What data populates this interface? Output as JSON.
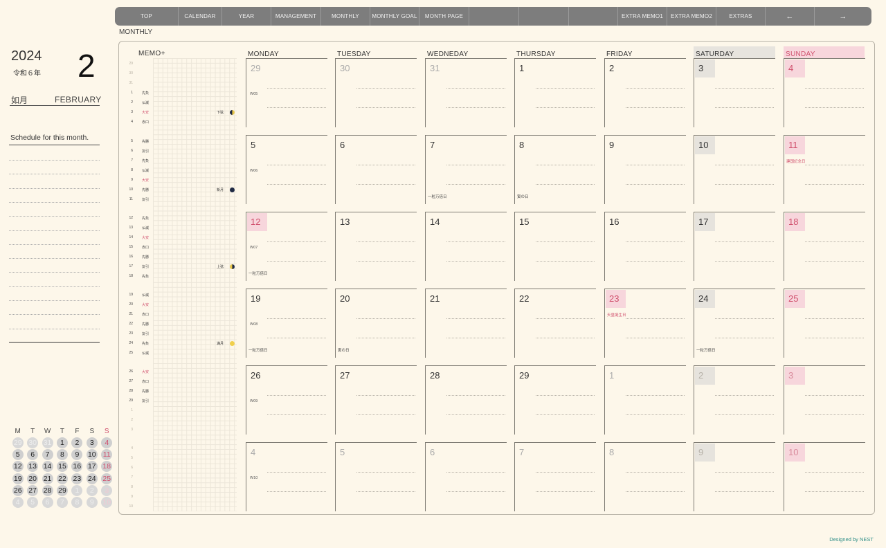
{
  "nav": {
    "tabs": [
      {
        "label": "TOP",
        "w": 92
      },
      {
        "label": "CALENDAR",
        "w": 63
      },
      {
        "label": "YEAR",
        "w": 71
      },
      {
        "label": "MANAGEMENT",
        "w": 72
      },
      {
        "label": "MONTHLY",
        "w": 71
      },
      {
        "label": "MONTHLY GOAL",
        "w": 71
      },
      {
        "label": "MONTH PAGE",
        "w": 72
      },
      {
        "label": "",
        "w": 72
      },
      {
        "label": "",
        "w": 72
      },
      {
        "label": "",
        "w": 71
      },
      {
        "label": "EXTRA MEMO1",
        "w": 71
      },
      {
        "label": "EXTRA MEMO2",
        "w": 71
      },
      {
        "label": "EXTRAS",
        "w": 71
      },
      {
        "label": "←",
        "w": 71
      },
      {
        "label": "→",
        "w": 82
      }
    ]
  },
  "page_label": "MONTHLY",
  "sidebar": {
    "year": "2024",
    "era": "令和６年",
    "month_number": "2",
    "month_jp": "如月",
    "month_en": "FEBRUARY",
    "schedule_title": "Schedule for this month."
  },
  "mini_calendar": {
    "headers": [
      "M",
      "T",
      "W",
      "T",
      "F",
      "S",
      "S"
    ],
    "weeks": [
      [
        [
          "29",
          1
        ],
        [
          "30",
          1
        ],
        [
          "31",
          1
        ],
        [
          "1",
          0
        ],
        [
          "2",
          0
        ],
        [
          "3",
          0
        ],
        [
          "4",
          0
        ]
      ],
      [
        [
          "5",
          0
        ],
        [
          "6",
          0
        ],
        [
          "7",
          0
        ],
        [
          "8",
          0
        ],
        [
          "9",
          0
        ],
        [
          "10",
          0
        ],
        [
          "11",
          0
        ]
      ],
      [
        [
          "12",
          0
        ],
        [
          "13",
          0
        ],
        [
          "14",
          0
        ],
        [
          "15",
          0
        ],
        [
          "16",
          0
        ],
        [
          "17",
          0
        ],
        [
          "18",
          0
        ]
      ],
      [
        [
          "19",
          0
        ],
        [
          "20",
          0
        ],
        [
          "21",
          0
        ],
        [
          "22",
          0
        ],
        [
          "23",
          0
        ],
        [
          "24",
          0
        ],
        [
          "25",
          0
        ]
      ],
      [
        [
          "26",
          0
        ],
        [
          "27",
          0
        ],
        [
          "28",
          0
        ],
        [
          "29",
          0
        ],
        [
          "1",
          1
        ],
        [
          "2",
          1
        ],
        [
          "3",
          1
        ]
      ],
      [
        [
          "4",
          1
        ],
        [
          "5",
          1
        ],
        [
          "6",
          1
        ],
        [
          "7",
          1
        ],
        [
          "8",
          1
        ],
        [
          "9",
          1
        ],
        [
          "10",
          1
        ]
      ]
    ]
  },
  "memo": {
    "title": "MEMO+",
    "rows": [
      {
        "d": "29",
        "rk": "",
        "f": 1
      },
      {
        "d": "30",
        "rk": "",
        "f": 1
      },
      {
        "d": "31",
        "rk": "",
        "f": 1
      },
      {
        "d": "1",
        "rk": "先負"
      },
      {
        "d": "2",
        "rk": "仏滅"
      },
      {
        "d": "3",
        "rk": "大安",
        "r": 1
      },
      {
        "d": "4",
        "rk": "赤口"
      },
      {
        "d": "5",
        "rk": "先勝"
      },
      {
        "d": "6",
        "rk": "友引"
      },
      {
        "d": "7",
        "rk": "先負"
      },
      {
        "d": "8",
        "rk": "仏滅"
      },
      {
        "d": "9",
        "rk": "大安",
        "r": 1
      },
      {
        "d": "10",
        "rk": "先勝"
      },
      {
        "d": "11",
        "rk": "友引"
      },
      {
        "d": "12",
        "rk": "先負"
      },
      {
        "d": "13",
        "rk": "仏滅"
      },
      {
        "d": "14",
        "rk": "大安",
        "r": 1
      },
      {
        "d": "15",
        "rk": "赤口"
      },
      {
        "d": "16",
        "rk": "先勝"
      },
      {
        "d": "17",
        "rk": "友引"
      },
      {
        "d": "18",
        "rk": "先負"
      },
      {
        "d": "19",
        "rk": "仏滅"
      },
      {
        "d": "20",
        "rk": "大安",
        "r": 1
      },
      {
        "d": "21",
        "rk": "赤口"
      },
      {
        "d": "22",
        "rk": "先勝"
      },
      {
        "d": "23",
        "rk": "友引"
      },
      {
        "d": "24",
        "rk": "先負"
      },
      {
        "d": "25",
        "rk": "仏滅"
      },
      {
        "d": "26",
        "rk": "大安",
        "r": 1
      },
      {
        "d": "27",
        "rk": "赤口"
      },
      {
        "d": "28",
        "rk": "先勝"
      },
      {
        "d": "29",
        "rk": "友引"
      },
      {
        "d": "1",
        "rk": "",
        "f": 1
      },
      {
        "d": "2",
        "rk": "",
        "f": 1
      },
      {
        "d": "3",
        "rk": "",
        "f": 1
      },
      {
        "d": "4",
        "rk": "",
        "f": 1
      },
      {
        "d": "5",
        "rk": "",
        "f": 1
      },
      {
        "d": "6",
        "rk": "",
        "f": 1
      },
      {
        "d": "7",
        "rk": "",
        "f": 1
      },
      {
        "d": "8",
        "rk": "",
        "f": 1
      },
      {
        "d": "9",
        "rk": "",
        "f": 1
      },
      {
        "d": "10",
        "rk": "",
        "f": 1
      }
    ],
    "moons": [
      {
        "row": 5,
        "label": "下弦",
        "phase": "last-quarter"
      },
      {
        "row": 12,
        "label": "新月",
        "phase": "new"
      },
      {
        "row": 19,
        "label": "上弦",
        "phase": "first-quarter"
      },
      {
        "row": 26,
        "label": "満月",
        "phase": "full"
      }
    ]
  },
  "weekdays": [
    "MONDAY",
    "TUESDAY",
    "WEDNEDAY",
    "THURSDAY",
    "FRIDAY",
    "SATURDAY",
    "SUNDAY"
  ],
  "weeks": [
    {
      "wk": "W05",
      "days": [
        {
          "n": "29",
          "o": 1
        },
        {
          "n": "30",
          "o": 1
        },
        {
          "n": "31",
          "o": 1
        },
        {
          "n": "1"
        },
        {
          "n": "2"
        },
        {
          "n": "3"
        },
        {
          "n": "4"
        }
      ]
    },
    {
      "wk": "W06",
      "days": [
        {
          "n": "5"
        },
        {
          "n": "6"
        },
        {
          "n": "7",
          "note": "一粒万倍日"
        },
        {
          "n": "8",
          "note": "寅の日"
        },
        {
          "n": "9"
        },
        {
          "n": "10"
        },
        {
          "n": "11",
          "hname": "建国記念日"
        }
      ]
    },
    {
      "wk": "W07",
      "days": [
        {
          "n": "12",
          "hol": 1,
          "note": "一粒万倍日"
        },
        {
          "n": "13"
        },
        {
          "n": "14"
        },
        {
          "n": "15"
        },
        {
          "n": "16"
        },
        {
          "n": "17"
        },
        {
          "n": "18"
        }
      ]
    },
    {
      "wk": "W08",
      "days": [
        {
          "n": "19",
          "note": "一粒万倍日"
        },
        {
          "n": "20",
          "note": "寅の日"
        },
        {
          "n": "21"
        },
        {
          "n": "22"
        },
        {
          "n": "23",
          "hol": 1,
          "hname": "天皇誕生日"
        },
        {
          "n": "24",
          "note": "一粒万倍日"
        },
        {
          "n": "25"
        }
      ]
    },
    {
      "wk": "W09",
      "days": [
        {
          "n": "26"
        },
        {
          "n": "27"
        },
        {
          "n": "28"
        },
        {
          "n": "29"
        },
        {
          "n": "1",
          "o": 1
        },
        {
          "n": "2",
          "o": 1
        },
        {
          "n": "3",
          "o": 1
        }
      ]
    },
    {
      "wk": "W10",
      "days": [
        {
          "n": "4",
          "o": 1
        },
        {
          "n": "5",
          "o": 1
        },
        {
          "n": "6",
          "o": 1
        },
        {
          "n": "7",
          "o": 1
        },
        {
          "n": "8",
          "o": 1
        },
        {
          "n": "9",
          "o": 1
        },
        {
          "n": "10",
          "o": 1
        }
      ]
    }
  ],
  "footer": "Designed by NEST"
}
